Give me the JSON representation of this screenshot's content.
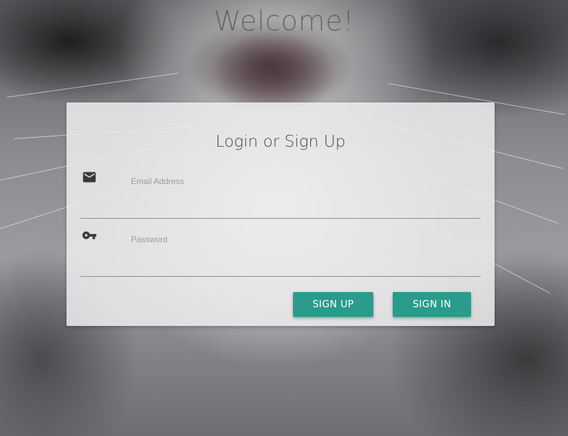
{
  "page": {
    "welcome_text": "Welcome!"
  },
  "login_card": {
    "title": "Login or Sign Up",
    "email_field": {
      "label": "Email Address",
      "value": "",
      "icon": "mail-icon"
    },
    "password_field": {
      "label": "Password",
      "value": "",
      "icon": "key-icon"
    },
    "buttons": {
      "sign_up": "SIGN UP",
      "sign_in": "SIGN IN"
    }
  },
  "colors": {
    "button_teal": "#2b9b8b",
    "card_background": "#ececee",
    "title_text": "#4a4a4a",
    "label_text": "#9a9a9a"
  }
}
